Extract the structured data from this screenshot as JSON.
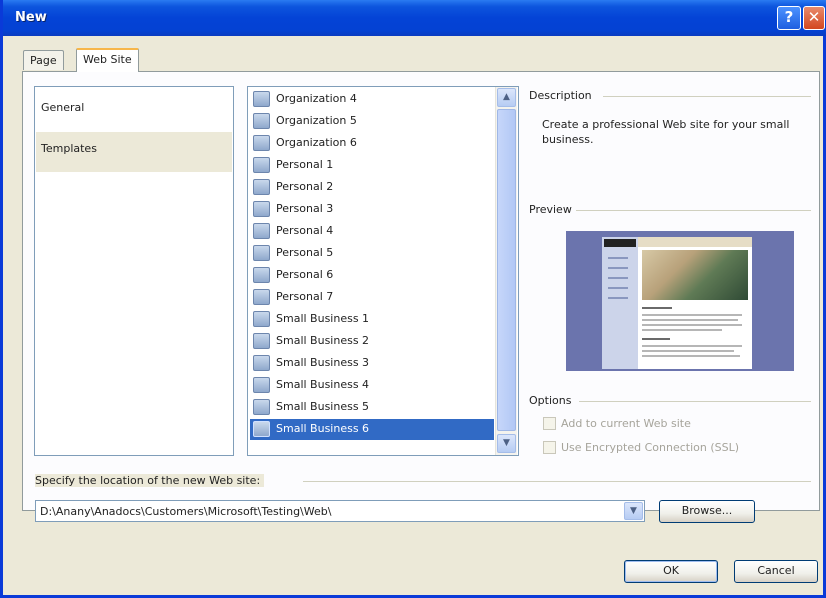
{
  "window": {
    "title": "New",
    "help_glyph": "?",
    "close_glyph": "✕"
  },
  "tabs": [
    {
      "label": "Page"
    },
    {
      "label": "Web Site"
    }
  ],
  "categories": [
    {
      "label": "General"
    },
    {
      "label": "Templates"
    }
  ],
  "templates": [
    {
      "label": "Organization 4"
    },
    {
      "label": "Organization 5"
    },
    {
      "label": "Organization 6"
    },
    {
      "label": "Personal 1"
    },
    {
      "label": "Personal 2"
    },
    {
      "label": "Personal 3"
    },
    {
      "label": "Personal 4"
    },
    {
      "label": "Personal 5"
    },
    {
      "label": "Personal 6"
    },
    {
      "label": "Personal 7"
    },
    {
      "label": "Small Business 1"
    },
    {
      "label": "Small Business 2"
    },
    {
      "label": "Small Business 3"
    },
    {
      "label": "Small Business 4"
    },
    {
      "label": "Small Business 5"
    },
    {
      "label": "Small Business 6",
      "selected": true
    }
  ],
  "description": {
    "label": "Description",
    "text": "Create a professional Web site for your small business."
  },
  "preview": {
    "label": "Preview",
    "logo_text": "LOGO"
  },
  "options": {
    "label": "Options",
    "add_to_current": {
      "label": "Add to current Web site",
      "checked": false,
      "disabled": true
    },
    "use_ssl": {
      "label": "Use Encrypted Connection (SSL)",
      "checked": false,
      "disabled": true
    }
  },
  "location": {
    "label": "Specify the location of the new Web site:",
    "value": "D:\\Anany\\Anadocs\\Customers\\Microsoft\\Testing\\Web\\"
  },
  "buttons": {
    "browse": "Browse...",
    "ok": "OK",
    "cancel": "Cancel"
  },
  "icons": {
    "scroll_up": "▲",
    "scroll_down": "▼",
    "combo_down": "▼",
    "template_icon": "web-template-icon"
  }
}
